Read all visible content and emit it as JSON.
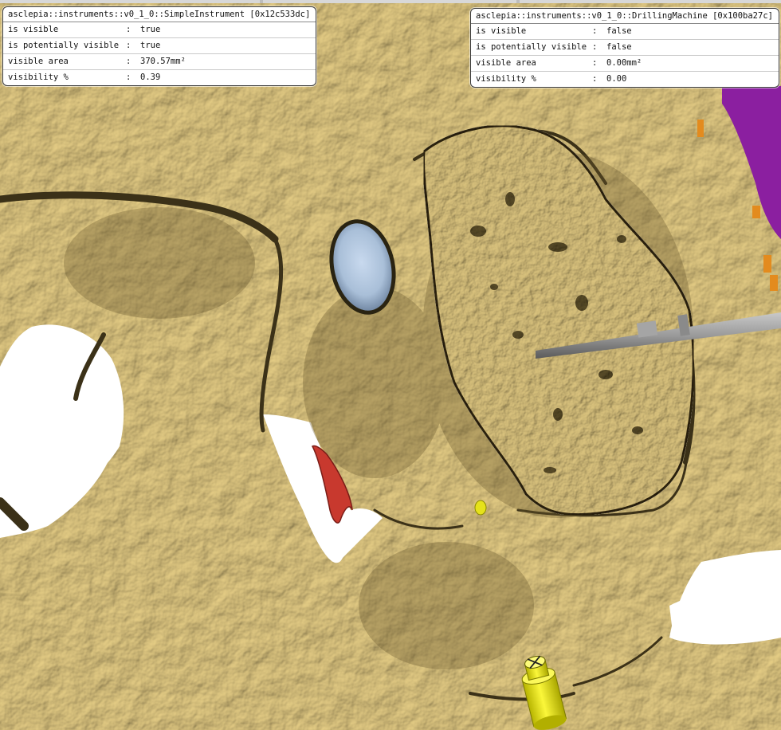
{
  "colors": {
    "bone": "#e3d4a1",
    "bone_shadow": "#6b5a2e",
    "background": "#ffffff",
    "cavity_blue": "#a9bfd8",
    "red_structure": "#c8392e",
    "purple_structure": "#8b1fa0",
    "orange_structure": "#e38b1e",
    "drill_bit": "#9a9a9a",
    "yellow_marker": "#f2ee10"
  },
  "panels": {
    "left": {
      "title": "asclepia::instruments::v0_1_0::SimpleInstrument [0x12c533dc]",
      "rows": [
        {
          "key": "is visible",
          "sep": ":",
          "value": "true"
        },
        {
          "key": "is potentially visible",
          "sep": ":",
          "value": "true"
        },
        {
          "key": "visible area",
          "sep": ":",
          "value": "370.57mm²"
        },
        {
          "key": "visibility %",
          "sep": ":",
          "value": "0.39"
        }
      ]
    },
    "right": {
      "title": "asclepia::instruments::v0_1_0::DrillingMachine [0x100ba27c]",
      "rows": [
        {
          "key": "is visible",
          "sep": ":",
          "value": "false"
        },
        {
          "key": "is potentially visible",
          "sep": ":",
          "value": "false"
        },
        {
          "key": "visible area",
          "sep": ":",
          "value": "0.00mm²"
        },
        {
          "key": "visibility %",
          "sep": ":",
          "value": "0.00"
        }
      ]
    }
  }
}
